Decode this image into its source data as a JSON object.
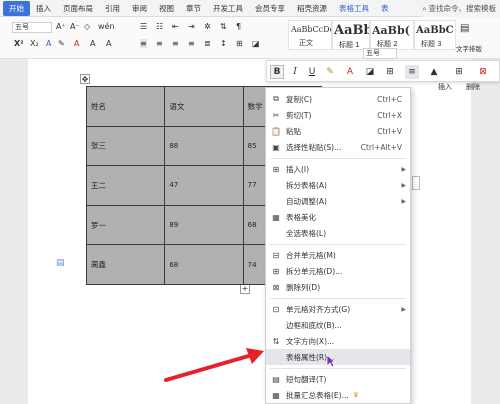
{
  "tabs": [
    "开始",
    "插入",
    "页面布局",
    "引用",
    "审阅",
    "视图",
    "章节",
    "开发工具",
    "会员专享",
    "稻壳资源",
    "表格工具",
    "表"
  ],
  "search": {
    "placeholder": "查找命令、搜索模板"
  },
  "ribbon": {
    "font_size_top": "五号",
    "font_size_mini": "五号",
    "styles": [
      {
        "preview": "AaBbCcDd",
        "label": "正文"
      },
      {
        "preview": "AaBb",
        "label": "标题 1"
      },
      {
        "preview": "AaBb(",
        "label": "标题 2"
      },
      {
        "preview": "AaBbC",
        "label": "标题 3"
      }
    ],
    "text_tool_label": "文字排版",
    "insert_label": "插入",
    "delete_label": "删除"
  },
  "table": {
    "rows": [
      [
        "姓名",
        "语文",
        "数学"
      ],
      [
        "张三",
        "88",
        "85"
      ],
      [
        "王二",
        "47",
        "77"
      ],
      [
        "罗一",
        "89",
        "68"
      ],
      [
        "蔺鑫",
        "68",
        "74"
      ]
    ]
  },
  "menu": {
    "items": [
      {
        "label": "复制(C)",
        "shortcut": "Ctrl+C",
        "icon": "copy-icon"
      },
      {
        "label": "剪切(T)",
        "shortcut": "Ctrl+X",
        "icon": "scissors-icon"
      },
      {
        "label": "粘贴",
        "shortcut": "Ctrl+V",
        "icon": "paste-icon"
      },
      {
        "label": "选择性粘贴(S)...",
        "shortcut": "Ctrl+Alt+V",
        "icon": "paste-special-icon"
      },
      {
        "label": "插入(I)",
        "shortcut": "",
        "icon": "insert-icon"
      },
      {
        "label": "拆分表格(A)",
        "shortcut": "",
        "icon": ""
      },
      {
        "label": "自动调整(A)",
        "shortcut": "",
        "icon": ""
      },
      {
        "label": "表格美化",
        "shortcut": "",
        "icon": "table-beautify-icon"
      },
      {
        "label": "全选表格(L)",
        "shortcut": "",
        "icon": ""
      },
      {
        "label": "合并单元格(M)",
        "shortcut": "",
        "icon": "merge-cells-icon"
      },
      {
        "label": "拆分单元格(D)...",
        "shortcut": "",
        "icon": "split-cells-icon"
      },
      {
        "label": "删除列(D)",
        "shortcut": "",
        "icon": "delete-column-icon"
      },
      {
        "label": "单元格对齐方式(G)",
        "shortcut": "",
        "icon": "cell-align-icon"
      },
      {
        "label": "边框和底纹(B)...",
        "shortcut": "",
        "icon": ""
      },
      {
        "label": "文字方向(X)...",
        "shortcut": "",
        "icon": "text-direction-icon"
      },
      {
        "label": "表格属性(R)...",
        "shortcut": "",
        "icon": ""
      },
      {
        "label": "短句翻译(T)",
        "shortcut": "",
        "icon": "translate-icon"
      },
      {
        "label": "批量汇总表格(E)...",
        "shortcut": "",
        "icon": "summary-icon"
      }
    ]
  },
  "colors": {
    "accent": "#3b73d9",
    "arrow": "#e8202a",
    "table_fill": "#b1b1b1"
  }
}
